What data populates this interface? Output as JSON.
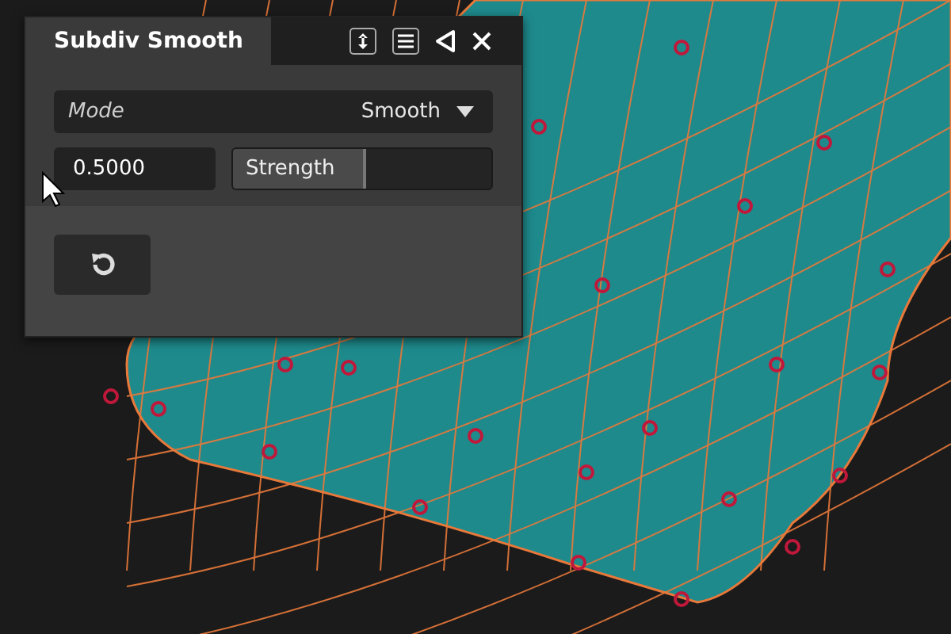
{
  "panel": {
    "title": "Subdiv Smooth"
  },
  "mode": {
    "label": "Mode",
    "value": "Smooth"
  },
  "strength": {
    "value": "0.5000",
    "label": "Strength",
    "level": 0.5
  }
}
